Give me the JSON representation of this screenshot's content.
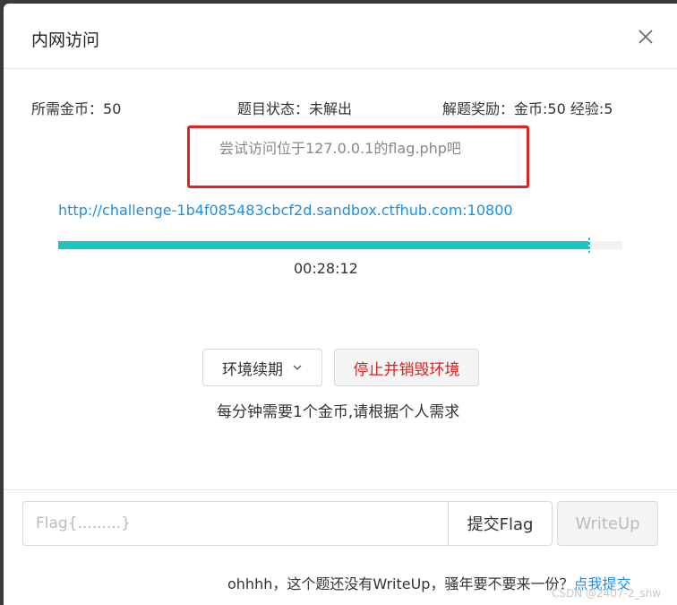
{
  "dialog": {
    "title": "内网访问"
  },
  "info": {
    "coins_label": "所需金币：",
    "coins_value": "50",
    "status_label": "题目状态：",
    "status_value": "未解出",
    "reward_label": "解题奖励：",
    "reward_value": "金币:50 经验:5"
  },
  "hint": "尝试访问位于127.0.0.1的flag.php吧",
  "challenge_url": "http://challenge-1b4f085483cbcf2d.sandbox.ctfhub.com:10800",
  "timer": {
    "remaining": "00:28:12",
    "progress_fraction": 0.94
  },
  "actions": {
    "renew_label": "环境续期",
    "stop_label": "停止并销毁环境",
    "cost_note": "每分钟需要1个金币,请根据个人需求"
  },
  "flag_form": {
    "placeholder": "Flag{.........}",
    "value": "",
    "submit_label": "提交Flag",
    "writeup_label": "WriteUp"
  },
  "footer": {
    "text": "ohhhh，这个题还没有WriteUp，骚年要不要来一份？",
    "link_label": "点我提交"
  },
  "watermark": "CSDN @2407-2_shw",
  "colors": {
    "accent": "#1ec4c2",
    "link": "#1c8ee8",
    "danger": "#e02020",
    "highlight_box": "#e42020"
  },
  "icons": {
    "close": "close-icon",
    "renew_dropdown": "chevron-down-icon"
  }
}
